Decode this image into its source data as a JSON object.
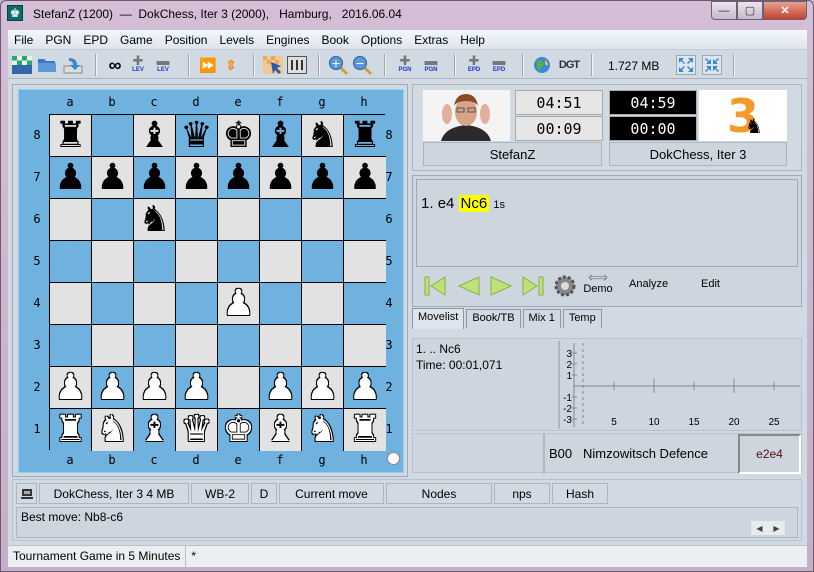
{
  "window": {
    "title": "StefanZ (1200)  —  DokChess, Iter 3 (2000),   Hamburg,   2016.06.04",
    "minimize": "—",
    "maximize": "▢",
    "close": "✕"
  },
  "menu": [
    "File",
    "PGN",
    "EPD",
    "Game",
    "Position",
    "Levels",
    "Engines",
    "Book",
    "Options",
    "Extras",
    "Help"
  ],
  "toolbar": {
    "buttons": [
      {
        "name": "new-board-icon",
        "glyph": "▦"
      },
      {
        "name": "open-folder-icon",
        "glyph": "📁"
      },
      {
        "name": "save-icon",
        "glyph": "⤵"
      },
      {
        "name": "infinite-icon",
        "glyph": "∞"
      },
      {
        "name": "add-level-icon",
        "glyph": "+",
        "label": "LEV"
      },
      {
        "name": "remove-level-icon",
        "glyph": "−",
        "label": "LEV"
      },
      {
        "name": "fast-forward-icon",
        "glyph": "⏩"
      },
      {
        "name": "flip-board-icon",
        "glyph": "⇕"
      },
      {
        "name": "setup-position-icon",
        "glyph": "▩"
      },
      {
        "name": "engine-settings-icon",
        "glyph": "☷"
      },
      {
        "name": "zoom-in-icon",
        "glyph": "🔍"
      },
      {
        "name": "zoom-out-icon",
        "glyph": "🔍"
      },
      {
        "name": "add-pgn-icon",
        "glyph": "+",
        "label": "PGN"
      },
      {
        "name": "remove-pgn-icon",
        "glyph": "−",
        "label": "PGN"
      },
      {
        "name": "add-epd-icon",
        "glyph": "+",
        "label": "EPD"
      },
      {
        "name": "remove-epd-icon",
        "glyph": "−",
        "label": "EPD"
      },
      {
        "name": "globe-icon",
        "glyph": "🌍"
      },
      {
        "name": "dgt-icon",
        "glyph": "DGT"
      },
      {
        "name": "expand-icon",
        "glyph": "⤢"
      },
      {
        "name": "collapse-icon",
        "glyph": "⤡"
      }
    ],
    "memory": "1.727 MB"
  },
  "board": {
    "files": [
      "a",
      "b",
      "c",
      "d",
      "e",
      "f",
      "g",
      "h"
    ],
    "ranks": [
      "8",
      "7",
      "6",
      "5",
      "4",
      "3",
      "2",
      "1"
    ],
    "position": [
      [
        "bR",
        "",
        "bB",
        "bQ",
        "bK",
        "bB",
        "bN",
        "bR"
      ],
      [
        "bP",
        "bP",
        "bP",
        "bP",
        "bP",
        "bP",
        "bP",
        "bP"
      ],
      [
        "",
        "",
        "bN",
        "",
        "",
        "",
        "",
        ""
      ],
      [
        "",
        "",
        "",
        "",
        "",
        "",
        "",
        ""
      ],
      [
        "",
        "",
        "",
        "",
        "wP",
        "",
        "",
        ""
      ],
      [
        "",
        "",
        "",
        "",
        "",
        "",
        "",
        ""
      ],
      [
        "wP",
        "wP",
        "wP",
        "wP",
        "",
        "wP",
        "wP",
        "wP"
      ],
      [
        "wR",
        "wN",
        "wB",
        "wQ",
        "wK",
        "wB",
        "wN",
        "wR"
      ]
    ],
    "side_to_move": "white",
    "colors": {
      "light": "#e2e2e2",
      "dark": "#6fb1df"
    }
  },
  "players": {
    "white": {
      "name": "StefanZ",
      "clock": "04:51",
      "move_time": "00:09"
    },
    "black": {
      "name": "DokChess, Iter 3",
      "clock": "04:59",
      "move_time": "00:00",
      "logo": "3"
    }
  },
  "notation": {
    "move_number": "1.",
    "white_move": "e4",
    "black_move": "Nc6",
    "black_time": "1s",
    "highlight_color": "#ffff00"
  },
  "nav": {
    "demo": "Demo",
    "analyze": "Analyze",
    "edit": "Edit"
  },
  "tabs": [
    "Movelist",
    "Book/TB",
    "Mix 1",
    "Temp"
  ],
  "move_info": {
    "line1": "1. .. Nc6",
    "line2": "Time: 00:01,071"
  },
  "eval_graph": {
    "y_ticks": [
      "3",
      "2",
      "1",
      "-1",
      "-2",
      "-3"
    ],
    "x_ticks": [
      "5",
      "10",
      "15",
      "20",
      "25"
    ]
  },
  "opening": {
    "eco": "B00",
    "name": "Nimzowitsch Defence",
    "last_move": "e2e4"
  },
  "engine": {
    "name": "DokChess, Iter 3  4 MB",
    "protocol": "WB-2",
    "depth": "D",
    "current_move": "Current move",
    "nodes": "Nodes",
    "nps": "nps",
    "hash": "Hash",
    "best_move": "Best move: Nb8-c6"
  },
  "status": {
    "game_type": "Tournament Game in 5 Minutes",
    "modified": "*"
  }
}
